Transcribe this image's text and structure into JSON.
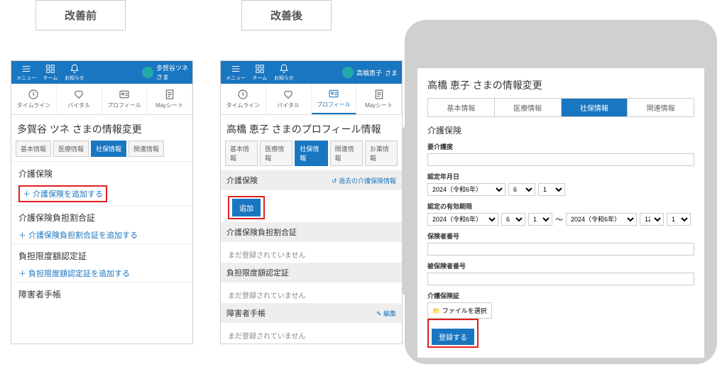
{
  "labels": {
    "before": "改善前",
    "after": "改善後"
  },
  "header": {
    "menu": "メニュー",
    "team": "チーム",
    "notice": "お知らせ",
    "userA": "多賀谷ツネ",
    "userB": "高橋恵子",
    "sama": "さま"
  },
  "navtabs": {
    "timeline": "タイムライン",
    "vital": "バイタル",
    "profile": "プロフィール",
    "sheet": "Mayシート"
  },
  "phoneA": {
    "title": "多賀谷 ツネ さまの情報変更",
    "tabs": {
      "basic": "基本情報",
      "medical": "医療情報",
      "social": "社保情報",
      "related": "関連情報"
    },
    "s1": {
      "h": "介護保険",
      "add": "＋ 介護保険を追加する"
    },
    "s2": {
      "h": "介護保険負担割合証",
      "add": "＋ 介護保険負担割合証を追加する"
    },
    "s3": {
      "h": "負担限度額認定証",
      "add": "＋ 負担限度額認定証を追加する"
    },
    "s4": {
      "h": "障害者手帳"
    }
  },
  "phoneB": {
    "title": "高橋 恵子 さまのプロフィール情報",
    "tabs": {
      "basic": "基本情報",
      "medical": "医療情報",
      "social": "社保情報",
      "related": "関連情報",
      "meds": "お薬情報"
    },
    "s1": {
      "h": "介護保険",
      "add": "追加",
      "past": "過去の介護保険情報"
    },
    "s2": {
      "h": "介護保険負担割合証",
      "none": "まだ登録されていません"
    },
    "s3": {
      "h": "負担限度額認定証",
      "none": "まだ登録されていません"
    },
    "s4": {
      "h": "障害者手帳",
      "edit": "編集",
      "none": "まだ登録されていません"
    }
  },
  "pop": {
    "title": "高橋 恵子 さまの情報変更",
    "tabs": {
      "basic": "基本情報",
      "medical": "医療情報",
      "social": "社保情報",
      "related": "関連情報"
    },
    "heading": "介護保険",
    "f_level": "要介護度",
    "f_certdate": "認定年月日",
    "f_valid": "認定の有効期限",
    "f_insno": "保険者番号",
    "f_insuredno": "被保険者番号",
    "f_cert": "介護保険証",
    "year_opt": "2024（令和6年）",
    "m_opt": "6",
    "d_opt": "1",
    "year_opt2": "2024（令和6年）",
    "m_opt2": "12",
    "d_opt2": "1",
    "dash": "～",
    "file": "📁 ファイルを選択",
    "submit": "登録する"
  }
}
